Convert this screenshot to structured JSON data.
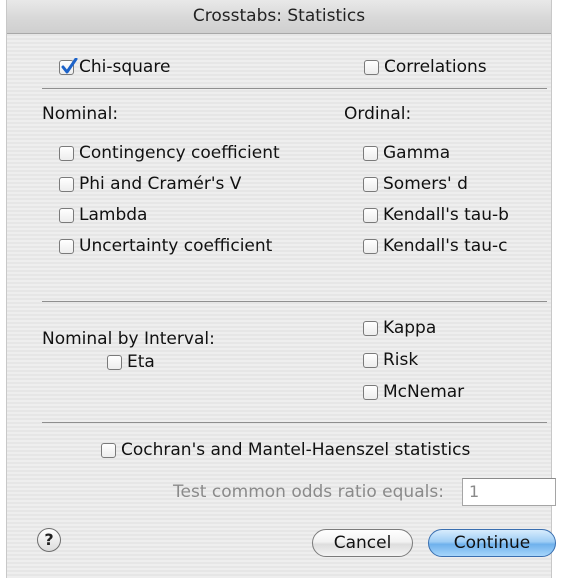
{
  "window": {
    "title": "Crosstabs: Statistics"
  },
  "top": {
    "chi_square": {
      "label": "Chi-square",
      "checked": true
    },
    "correlations": {
      "label": "Correlations",
      "checked": false
    }
  },
  "nominal": {
    "heading": "Nominal:",
    "items": [
      {
        "label": "Contingency coefficient",
        "checked": false
      },
      {
        "label": "Phi and Cramér's V",
        "checked": false
      },
      {
        "label": "Lambda",
        "checked": false
      },
      {
        "label": "Uncertainty coefficient",
        "checked": false
      }
    ]
  },
  "ordinal": {
    "heading": "Ordinal:",
    "items": [
      {
        "label": "Gamma",
        "checked": false
      },
      {
        "label": "Somers' d",
        "checked": false
      },
      {
        "label": "Kendall's tau-b",
        "checked": false
      },
      {
        "label": "Kendall's tau-c",
        "checked": false
      }
    ]
  },
  "nominal_by_interval": {
    "heading": "Nominal by Interval:",
    "eta": {
      "label": "Eta",
      "checked": false
    }
  },
  "other": {
    "items": [
      {
        "label": "Kappa",
        "checked": false
      },
      {
        "label": "Risk",
        "checked": false
      },
      {
        "label": "McNemar",
        "checked": false
      }
    ]
  },
  "cochran": {
    "label": "Cochran's and Mantel-Haenszel statistics",
    "checked": false,
    "odds_label": "Test common odds ratio equals:",
    "odds_value": "1"
  },
  "buttons": {
    "help": "?",
    "cancel": "Cancel",
    "continue": "Continue"
  },
  "colors": {
    "accent": "#6fb1ec",
    "check": "#1d63c9"
  }
}
